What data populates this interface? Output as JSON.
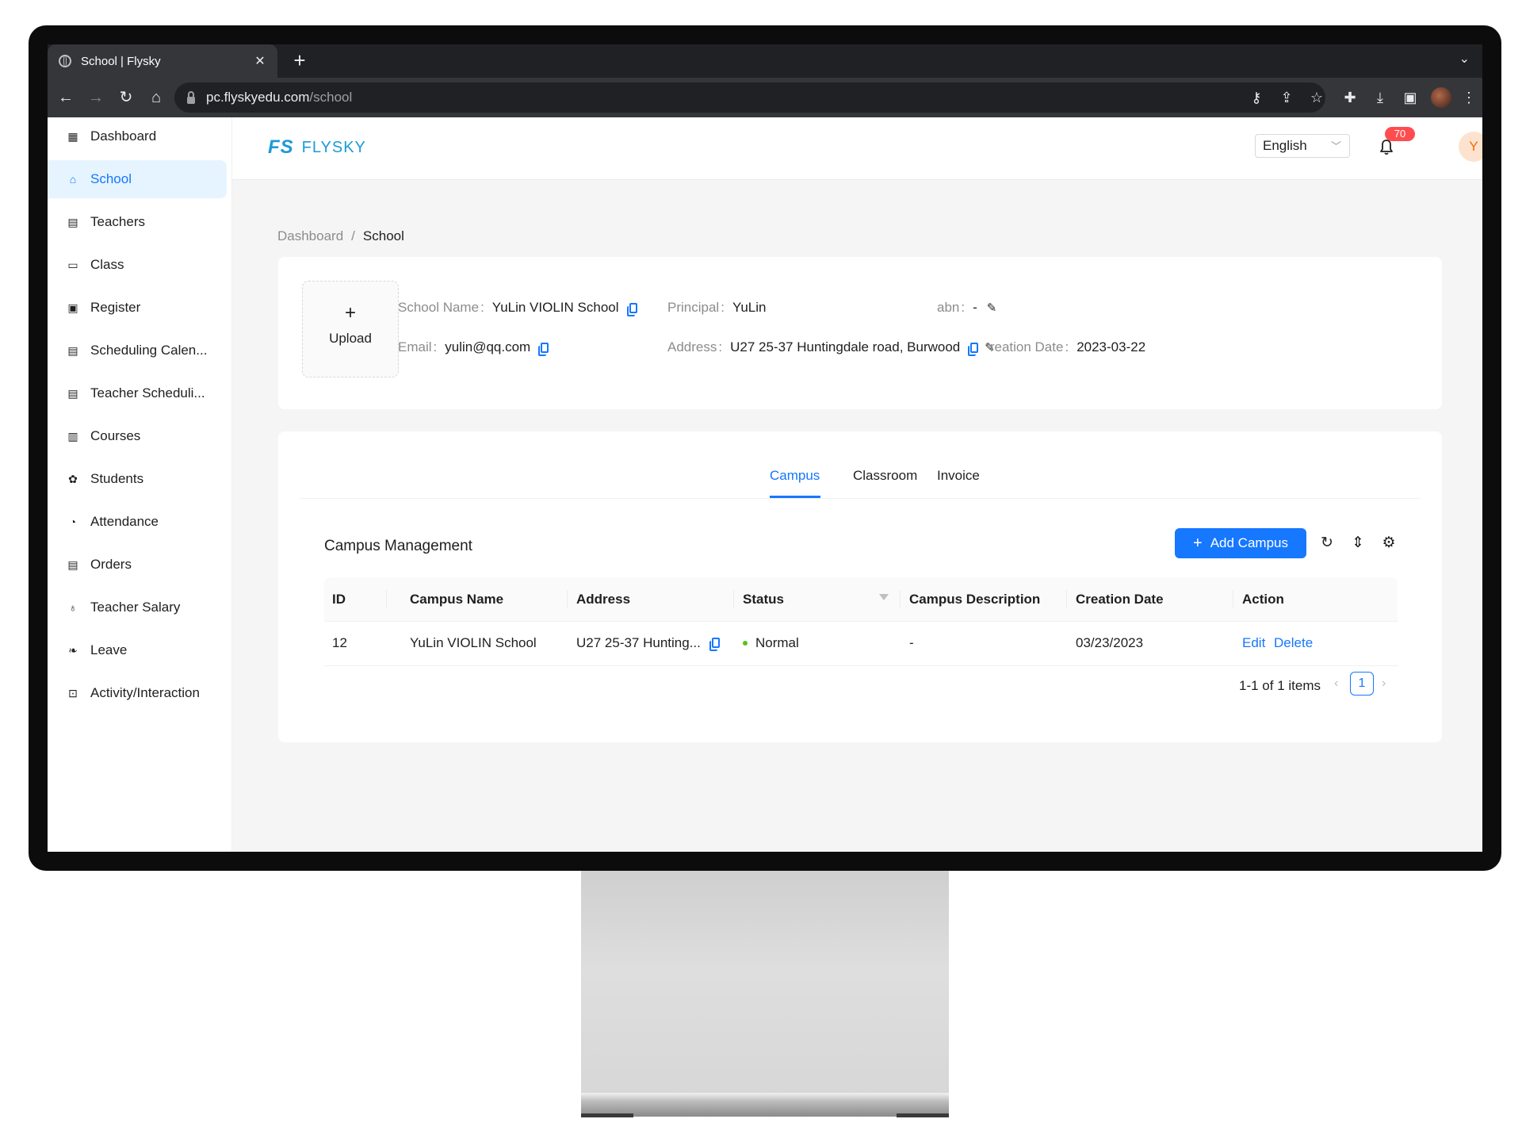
{
  "browser": {
    "tab_title": "School | Flysky",
    "url_host": "pc.flyskyedu.com",
    "url_path": "/school"
  },
  "sidebar": {
    "items": [
      {
        "label": "Dashboard",
        "icon": "dashboard-icon"
      },
      {
        "label": "School",
        "icon": "school-icon",
        "active": true
      },
      {
        "label": "Teachers",
        "icon": "teachers-icon"
      },
      {
        "label": "Class",
        "icon": "class-icon"
      },
      {
        "label": "Register",
        "icon": "register-icon"
      },
      {
        "label": "Scheduling Calen...",
        "icon": "calendar-icon"
      },
      {
        "label": "Teacher Scheduli...",
        "icon": "calendar-icon"
      },
      {
        "label": "Courses",
        "icon": "courses-icon"
      },
      {
        "label": "Students",
        "icon": "students-icon"
      },
      {
        "label": "Attendance",
        "icon": "attendance-icon"
      },
      {
        "label": "Orders",
        "icon": "orders-icon"
      },
      {
        "label": "Teacher Salary",
        "icon": "salary-icon"
      },
      {
        "label": "Leave",
        "icon": "leave-icon"
      },
      {
        "label": "Activity/Interaction",
        "icon": "activity-icon"
      }
    ]
  },
  "header": {
    "logo_mark": "FS",
    "logo_text": "FLYSKY",
    "language": "English",
    "notification_count": "70",
    "user_initial": "Y"
  },
  "breadcrumb": {
    "root": "Dashboard",
    "separator": "/",
    "current": "School"
  },
  "school": {
    "upload_label": "Upload",
    "name_label": "School Name",
    "name": "YuLin VIOLIN School",
    "principal_label": "Principal",
    "principal": "YuLin",
    "abn_label": "abn",
    "abn": "-",
    "email_label": "Email",
    "email": "yulin@qq.com",
    "address_label": "Address",
    "address": "U27 25-37 Huntingdale road, Burwood",
    "creation_label": "reation Date",
    "creation_date": "2023-03-22",
    "colon": ":"
  },
  "tabs": [
    {
      "label": "Campus",
      "active": true
    },
    {
      "label": "Classroom"
    },
    {
      "label": "Invoice"
    }
  ],
  "campus": {
    "title": "Campus Management",
    "add_button": "Add Campus",
    "columns": [
      "ID",
      "Campus Name",
      "Address",
      "Status",
      "Campus Description",
      "Creation Date",
      "Action"
    ],
    "rows": [
      {
        "id": "12",
        "name": "YuLin VIOLIN School",
        "address": "U27 25-37 Hunting...",
        "status": "Normal",
        "description": "-",
        "creation_date": "03/23/2023",
        "edit": "Edit",
        "delete": "Delete"
      }
    ],
    "pagination": {
      "total": "1-1 of 1 items",
      "current_page": "1"
    }
  },
  "colors": {
    "primary": "#1677ff",
    "status_normal": "#52c41a",
    "badge": "#ff4d4f",
    "logo": "#1c9bd6"
  }
}
